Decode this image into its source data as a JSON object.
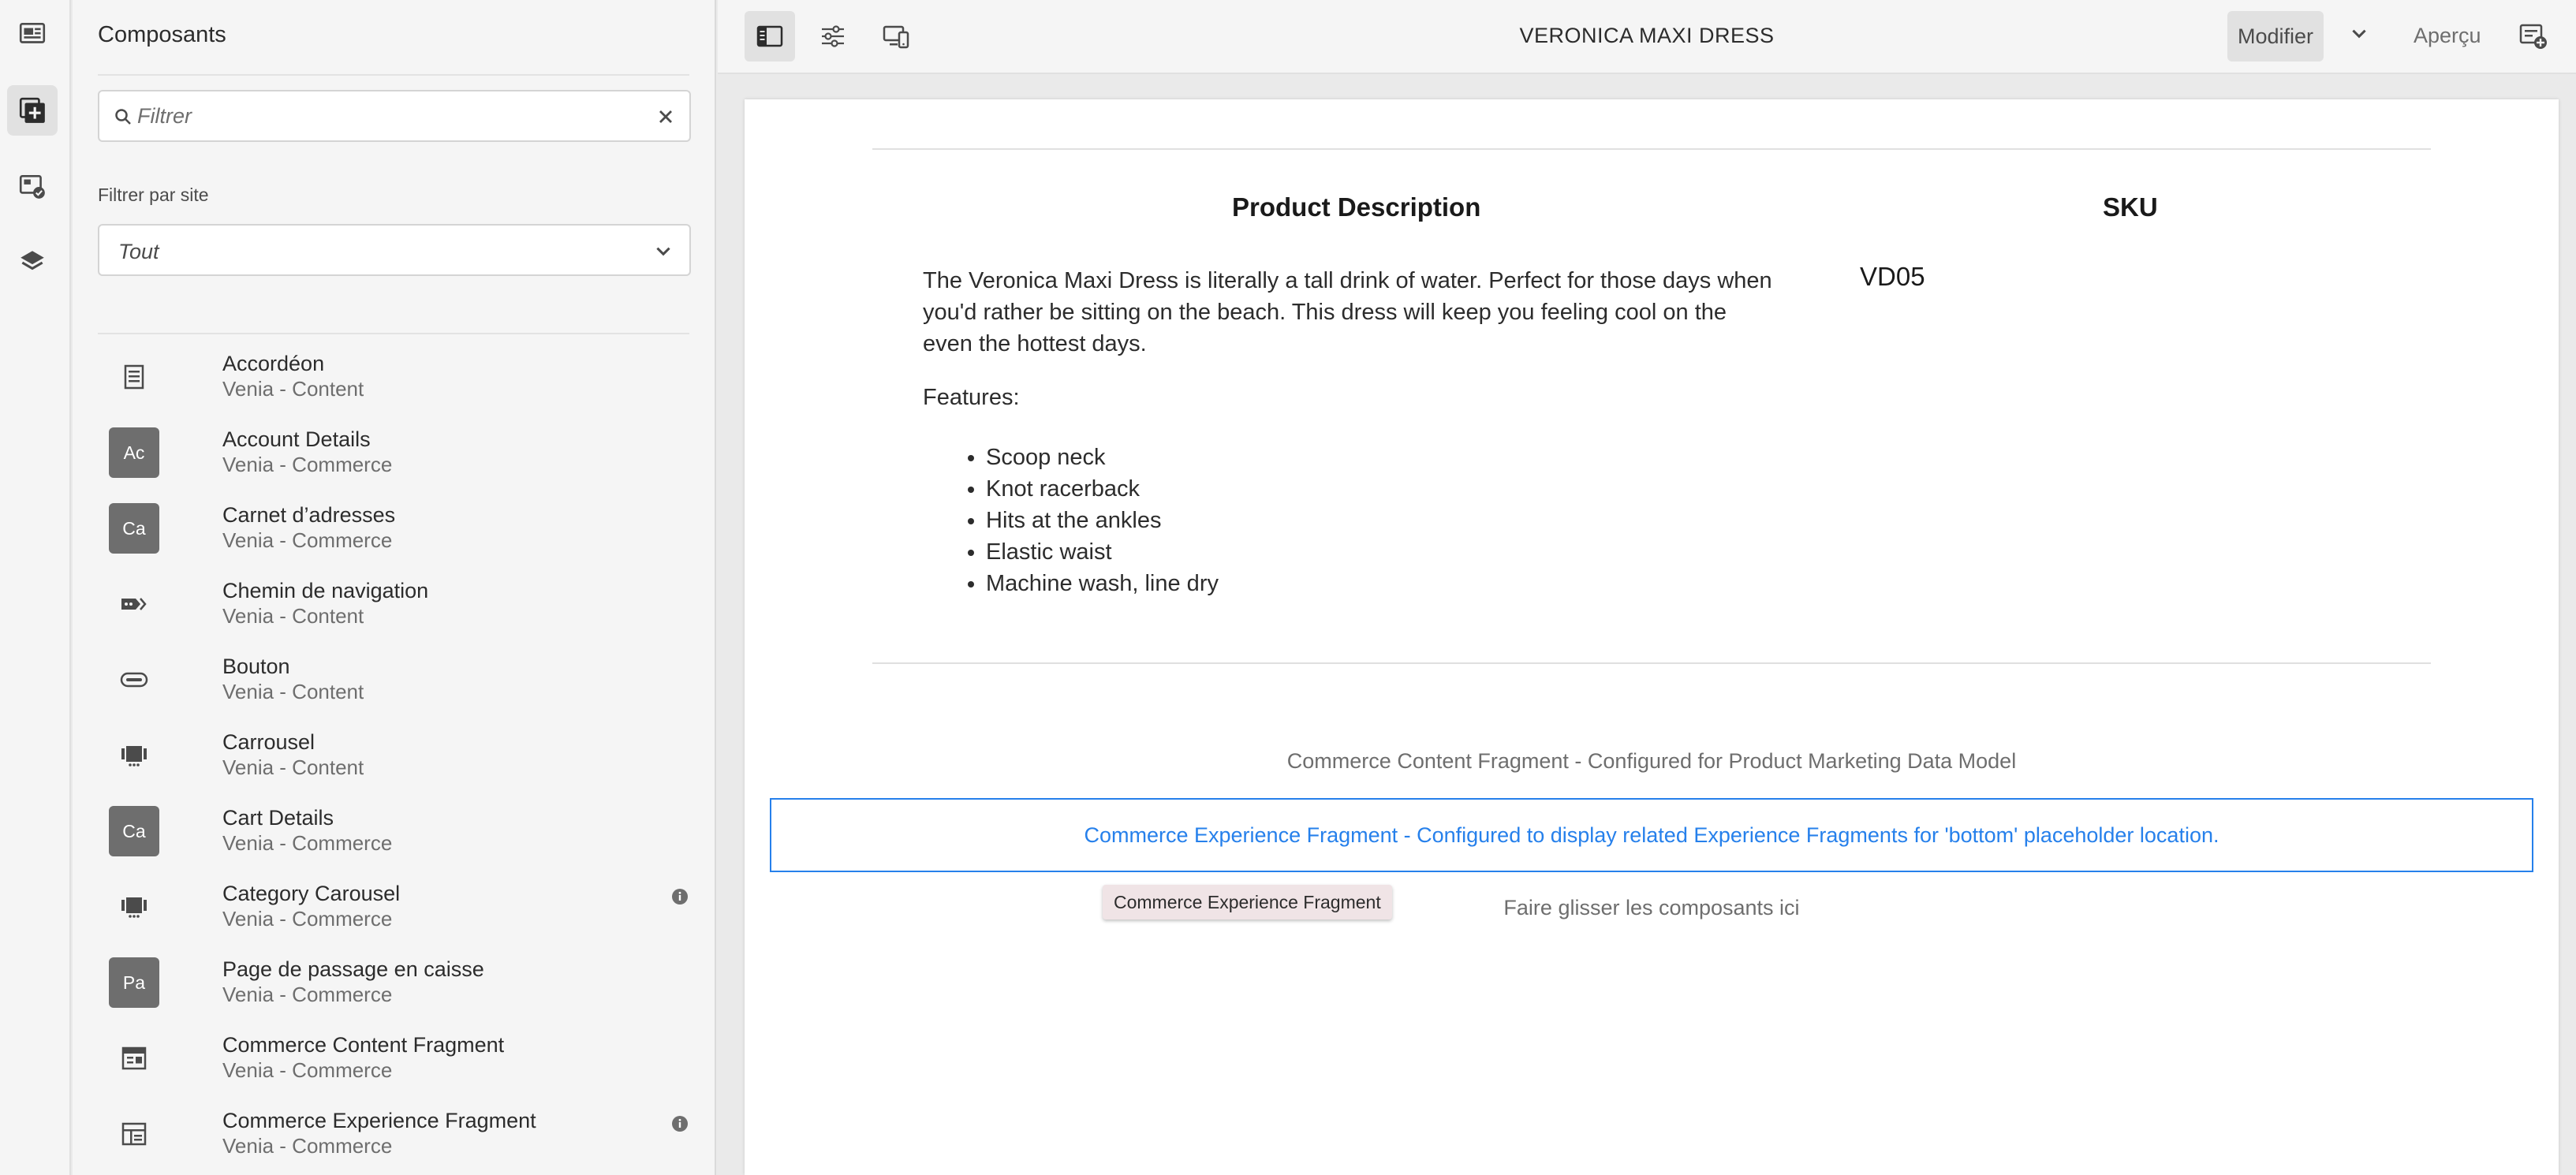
{
  "panel": {
    "title": "Composants",
    "search_placeholder": "Filtrer",
    "site_filter_label": "Filtrer par site",
    "site_filter_value": "Tout"
  },
  "components": [
    {
      "name": "Accordéon",
      "group": "Venia - Content",
      "icon": "accordion-icon",
      "abbr": ""
    },
    {
      "name": "Account Details",
      "group": "Venia - Commerce",
      "icon": "abbr-badge",
      "abbr": "Ac"
    },
    {
      "name": "Carnet d’adresses",
      "group": "Venia - Commerce",
      "icon": "abbr-badge",
      "abbr": "Ca"
    },
    {
      "name": "Chemin de navigation",
      "group": "Venia - Content",
      "icon": "breadcrumb-icon",
      "abbr": ""
    },
    {
      "name": "Bouton",
      "group": "Venia - Content",
      "icon": "button-icon",
      "abbr": ""
    },
    {
      "name": "Carrousel",
      "group": "Venia - Content",
      "icon": "carousel-icon",
      "abbr": ""
    },
    {
      "name": "Cart Details",
      "group": "Venia - Commerce",
      "icon": "abbr-badge",
      "abbr": "Ca"
    },
    {
      "name": "Category Carousel",
      "group": "Venia - Commerce",
      "icon": "carousel-icon",
      "abbr": ""
    },
    {
      "name": "Page de passage en caisse",
      "group": "Venia - Commerce",
      "icon": "abbr-badge",
      "abbr": "Pa"
    },
    {
      "name": "Commerce Content Fragment",
      "group": "Venia - Commerce",
      "icon": "content-fragment-icon",
      "abbr": ""
    },
    {
      "name": "Commerce Experience Fragment",
      "group": "Venia - Commerce",
      "icon": "experience-fragment-icon",
      "abbr": ""
    }
  ],
  "toolbar": {
    "page_title": "VERONICA MAXI DRESS",
    "mode_label": "Modifier",
    "preview_label": "Aperçu"
  },
  "canvas": {
    "desc_heading": "Product Description",
    "sku_heading": "SKU",
    "description": "The Veronica Maxi Dress is literally a tall drink of water. Perfect for those days when you'd rather be sitting on the beach. This dress will keep you feeling cool on the even the hottest days.",
    "features_label": "Features:",
    "features": [
      "Scoop neck",
      "Knot racerback",
      "Hits at the ankles",
      "Elastic waist",
      "Machine wash, line dry"
    ],
    "sku_value": "VD05",
    "content_fragment_label": "Commerce Content Fragment - Configured for Product Marketing Data Model",
    "experience_fragment_label": "Commerce Experience Fragment - Configured to display related Experience Fragments for 'bottom' placeholder location.",
    "tooltip": "Commerce Experience Fragment",
    "drop_hint": "Faire glisser les composants ici"
  },
  "colors": {
    "accent": "#2680eb",
    "badge": "#6e6e6e",
    "panel_bg": "#f5f5f5",
    "canvas_bg": "#ffffff"
  }
}
